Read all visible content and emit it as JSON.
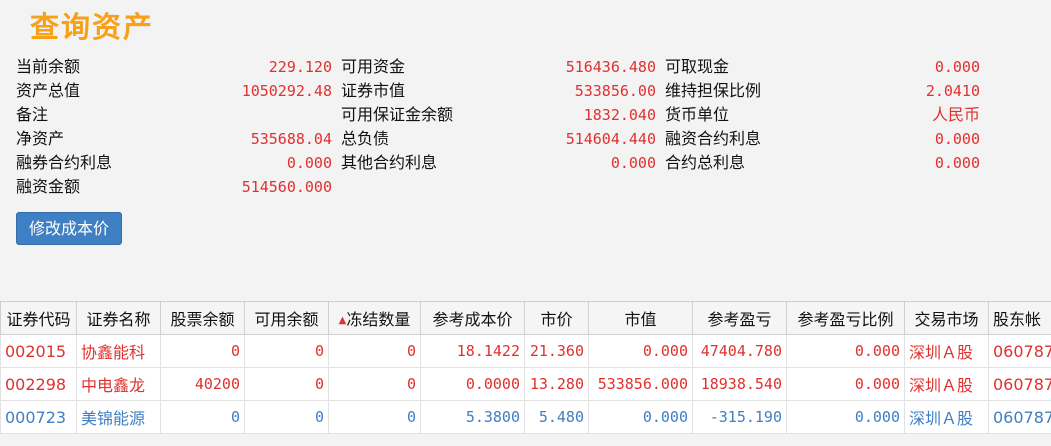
{
  "title": "查询资产",
  "summary": {
    "cur_balance": {
      "label": "当前余额",
      "value": "229.120"
    },
    "total_assets": {
      "label": "资产总值",
      "value": "1050292.48"
    },
    "remark": {
      "label": "备注",
      "value": ""
    },
    "net_assets": {
      "label": "净资产",
      "value": "535688.04"
    },
    "sec_loan_interest": {
      "label": "融券合约利息",
      "value": "0.000"
    },
    "financing_amount": {
      "label": "融资金额",
      "value": "514560.000"
    },
    "available_funds": {
      "label": "可用资金",
      "value": "516436.480"
    },
    "market_value": {
      "label": "证券市值",
      "value": "533856.00"
    },
    "available_margin": {
      "label": "可用保证金余额",
      "value": "1832.040"
    },
    "total_liabilities": {
      "label": "总负债",
      "value": "514604.440"
    },
    "other_interest": {
      "label": "其他合约利息",
      "value": "0.000"
    },
    "withdrawable_cash": {
      "label": "可取现金",
      "value": "0.000"
    },
    "maintenance_ratio": {
      "label": "维持担保比例",
      "value": "2.0410"
    },
    "currency": {
      "label": "货币单位",
      "value": "人民币"
    },
    "financing_interest": {
      "label": "融资合约利息",
      "value": "0.000"
    },
    "total_interest": {
      "label": "合约总利息",
      "value": "0.000"
    }
  },
  "button": {
    "label": "修改成本价"
  },
  "table": {
    "headers": [
      "证券代码",
      "证券名称",
      "股票余额",
      "可用余额",
      "冻结数量",
      "参考成本价",
      "市价",
      "市值",
      "参考盈亏",
      "参考盈亏比例",
      "交易市场",
      "股东帐"
    ],
    "sort_indicator": "▲",
    "rows": [
      {
        "code": "002015",
        "name": "协鑫能科",
        "stock_balance": "0",
        "available": "0",
        "frozen": "0",
        "cost": "18.1422",
        "price": "21.360",
        "mv": "0.000",
        "pnl": "47404.780",
        "pnl_ratio": "0.000",
        "market": "深圳Ａ股",
        "holder": "060787"
      },
      {
        "code": "002298",
        "name": "中电鑫龙",
        "stock_balance": "40200",
        "available": "0",
        "frozen": "0",
        "cost": "0.0000",
        "price": "13.280",
        "mv": "533856.000",
        "pnl": "18938.540",
        "pnl_ratio": "0.000",
        "market": "深圳Ａ股",
        "holder": "060787"
      },
      {
        "code": "000723",
        "name": "美锦能源",
        "stock_balance": "0",
        "available": "0",
        "frozen": "0",
        "cost": "5.3800",
        "price": "5.480",
        "mv": "0.000",
        "pnl": "-315.190",
        "pnl_ratio": "0.000",
        "market": "深圳Ａ股",
        "holder": "060787"
      }
    ]
  }
}
